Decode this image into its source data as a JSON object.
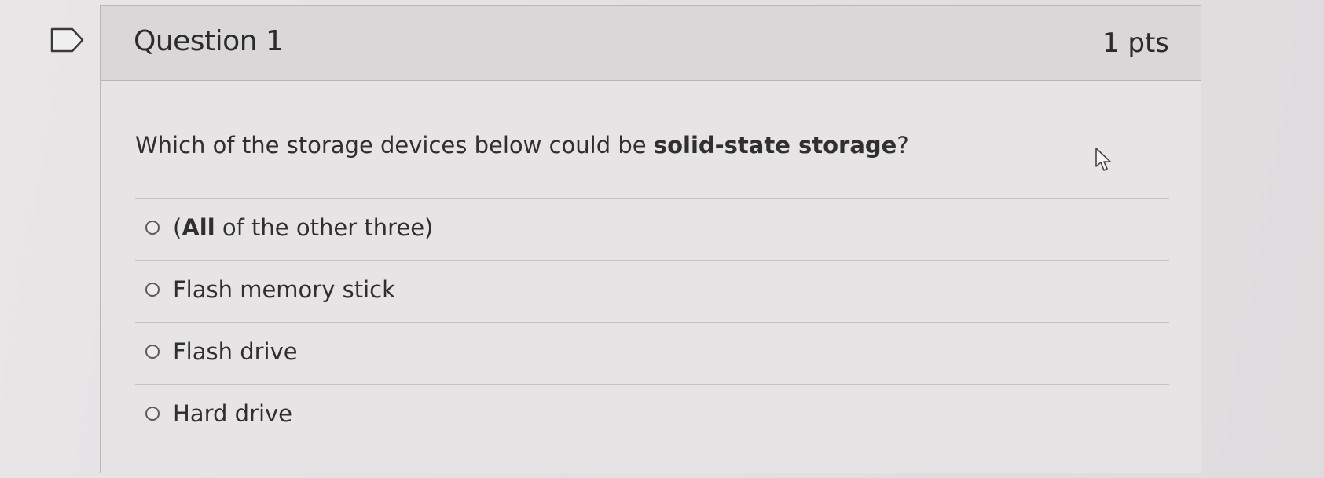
{
  "question": {
    "title": "Question 1",
    "points": "1 pts",
    "prompt_prefix": "Which of the storage devices below could be ",
    "prompt_emphasis": "solid-state storage",
    "prompt_suffix": "?"
  },
  "answers": [
    {
      "prefix": "(",
      "emphasis": "All",
      "suffix": " of the other three)",
      "selected": false
    },
    {
      "label": "Flash memory stick",
      "selected": false
    },
    {
      "label": "Flash drive",
      "selected": false
    },
    {
      "label": "Hard drive",
      "selected": false
    }
  ],
  "icons": {
    "flag": "flag-icon",
    "cursor": "mouse-pointer-icon",
    "radio": "radio-button-icon"
  }
}
